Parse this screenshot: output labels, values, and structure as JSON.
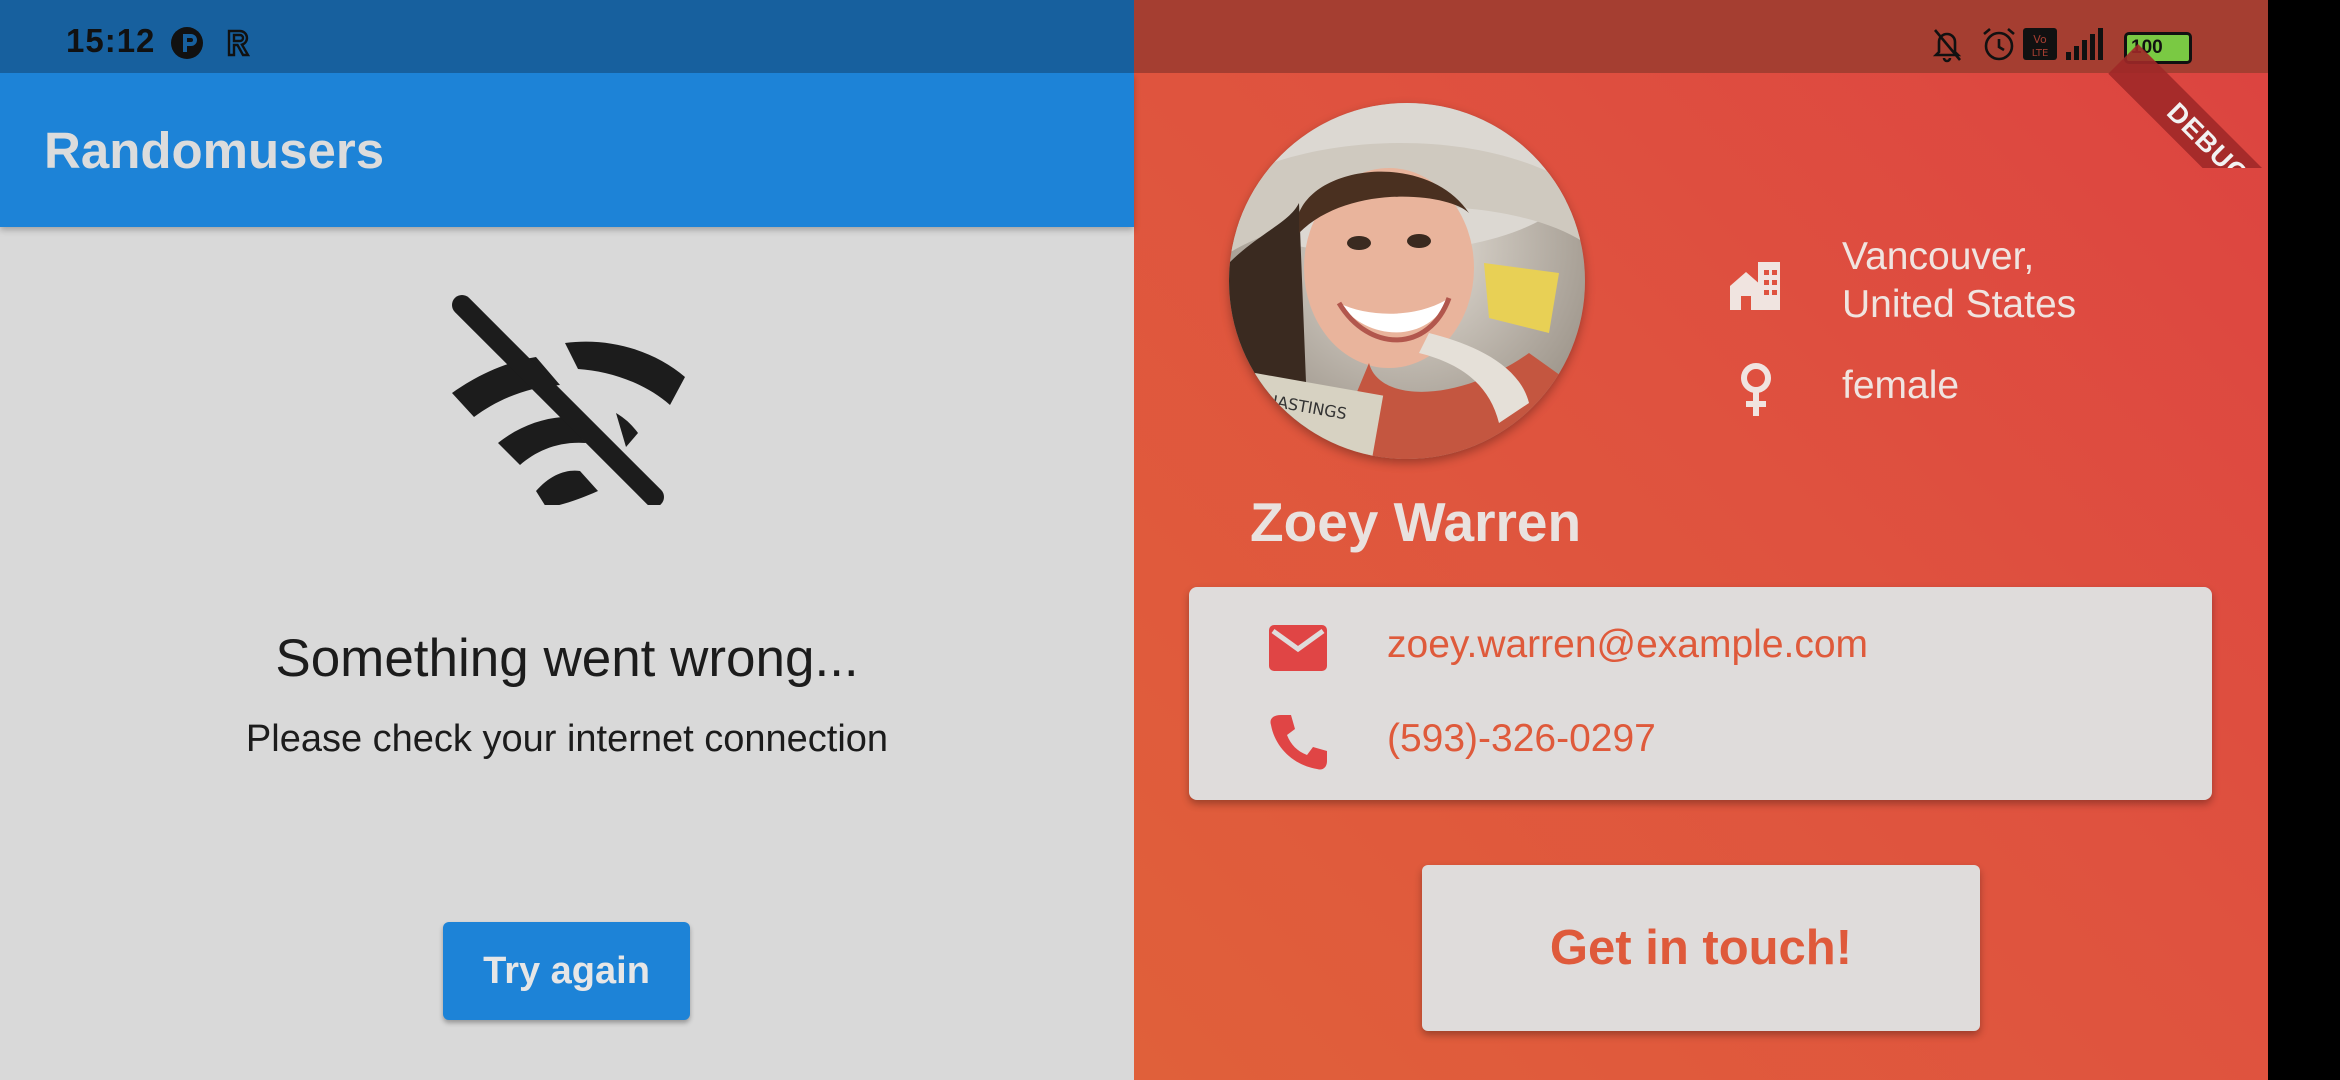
{
  "status_bar": {
    "time": "15:12",
    "battery": "100"
  },
  "app_bar": {
    "title": "Randomusers"
  },
  "error": {
    "title": "Something went wrong...",
    "subtitle": "Please check your internet connection",
    "retry_label": "Try again"
  },
  "profile": {
    "name": "Zoey Warren",
    "location_line1": "Vancouver,",
    "location_line2": "United States",
    "gender": "female",
    "email": "zoey.warren@example.com",
    "phone": "(593)-326-0297",
    "cta_label": "Get in touch!"
  },
  "debug": {
    "label": "DEBUG"
  },
  "colors": {
    "primary_blue": "#1d83d7",
    "accent_orange": "#df5a3b",
    "icon_red": "#e04545"
  }
}
